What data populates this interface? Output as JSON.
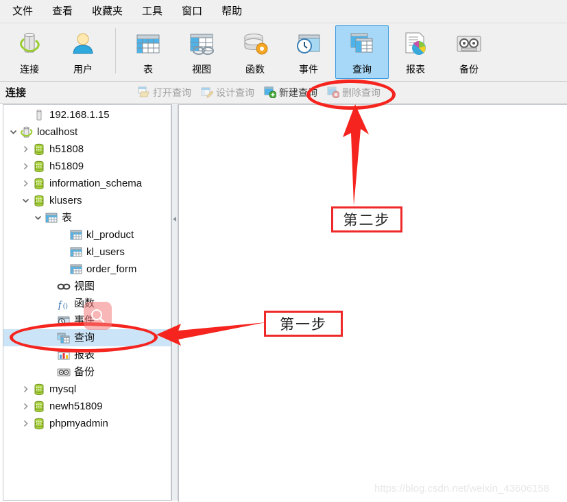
{
  "menu": {
    "items": [
      {
        "label": "文件",
        "name": "menu-file"
      },
      {
        "label": "查看",
        "name": "menu-view"
      },
      {
        "label": "收藏夹",
        "name": "menu-favorites"
      },
      {
        "label": "工具",
        "name": "menu-tools"
      },
      {
        "label": "窗口",
        "name": "menu-window"
      },
      {
        "label": "帮助",
        "name": "menu-help"
      }
    ]
  },
  "toolbar": {
    "buttons": [
      {
        "label": "连接",
        "icon": "connection-icon",
        "selected": false
      },
      {
        "label": "用户",
        "icon": "user-icon",
        "selected": false
      },
      {
        "label": "表",
        "icon": "table-icon",
        "selected": false
      },
      {
        "label": "视图",
        "icon": "view-icon",
        "selected": false
      },
      {
        "label": "函数",
        "icon": "function-icon",
        "selected": false
      },
      {
        "label": "事件",
        "icon": "event-icon",
        "selected": false
      },
      {
        "label": "查询",
        "icon": "query-icon",
        "selected": true
      },
      {
        "label": "报表",
        "icon": "report-icon",
        "selected": false
      },
      {
        "label": "备份",
        "icon": "backup-icon",
        "selected": false
      }
    ]
  },
  "subbar": {
    "title": "连接",
    "actions": [
      {
        "label": "打开查询",
        "icon": "open-query-icon",
        "disabled": true
      },
      {
        "label": "设计查询",
        "icon": "design-query-icon",
        "disabled": true
      },
      {
        "label": "新建查询",
        "icon": "new-query-icon",
        "disabled": false
      },
      {
        "label": "删除查询",
        "icon": "delete-query-icon",
        "disabled": true
      }
    ]
  },
  "tree": {
    "nodes": [
      {
        "label": "192.168.1.15",
        "icon": "server-offline-icon",
        "indent": 1,
        "twist": "",
        "selected": false
      },
      {
        "label": "localhost",
        "icon": "server-connected-icon",
        "indent": 0,
        "twist": "expanded",
        "selected": false
      },
      {
        "label": "h51808",
        "icon": "database-icon",
        "indent": 1,
        "twist": "collapsed",
        "selected": false
      },
      {
        "label": "h51809",
        "icon": "database-icon",
        "indent": 1,
        "twist": "collapsed",
        "selected": false
      },
      {
        "label": "information_schema",
        "icon": "database-icon",
        "indent": 1,
        "twist": "collapsed",
        "selected": false
      },
      {
        "label": "klusers",
        "icon": "database-icon",
        "indent": 1,
        "twist": "expanded",
        "selected": false
      },
      {
        "label": "表",
        "icon": "table-icon",
        "indent": 2,
        "twist": "expanded",
        "selected": false
      },
      {
        "label": "kl_product",
        "icon": "table-icon",
        "indent": 4,
        "twist": "",
        "selected": false
      },
      {
        "label": "kl_users",
        "icon": "table-icon",
        "indent": 4,
        "twist": "",
        "selected": false
      },
      {
        "label": "order_form",
        "icon": "table-icon",
        "indent": 4,
        "twist": "",
        "selected": false
      },
      {
        "label": "视图",
        "icon": "view-icon",
        "indent": 3,
        "twist": "",
        "selected": false
      },
      {
        "label": "函数",
        "icon": "function-icon",
        "indent": 3,
        "twist": "",
        "selected": false
      },
      {
        "label": "事件",
        "icon": "event-icon",
        "indent": 3,
        "twist": "",
        "selected": false
      },
      {
        "label": "查询",
        "icon": "query-icon",
        "indent": 3,
        "twist": "",
        "selected": true
      },
      {
        "label": "报表",
        "icon": "report-icon",
        "indent": 3,
        "twist": "",
        "selected": false
      },
      {
        "label": "备份",
        "icon": "backup-icon",
        "indent": 3,
        "twist": "",
        "selected": false
      },
      {
        "label": "mysql",
        "icon": "database-icon",
        "indent": 1,
        "twist": "collapsed",
        "selected": false
      },
      {
        "label": "newh51809",
        "icon": "database-icon",
        "indent": 1,
        "twist": "collapsed",
        "selected": false
      },
      {
        "label": "phpmyadmin",
        "icon": "database-icon",
        "indent": 1,
        "twist": "collapsed",
        "selected": false
      }
    ]
  },
  "annotations": {
    "step1": "第一步",
    "step2": "第二步",
    "accent_color": "#f5241e"
  },
  "watermark": "https://blog.csdn.net/weixin_43606158"
}
